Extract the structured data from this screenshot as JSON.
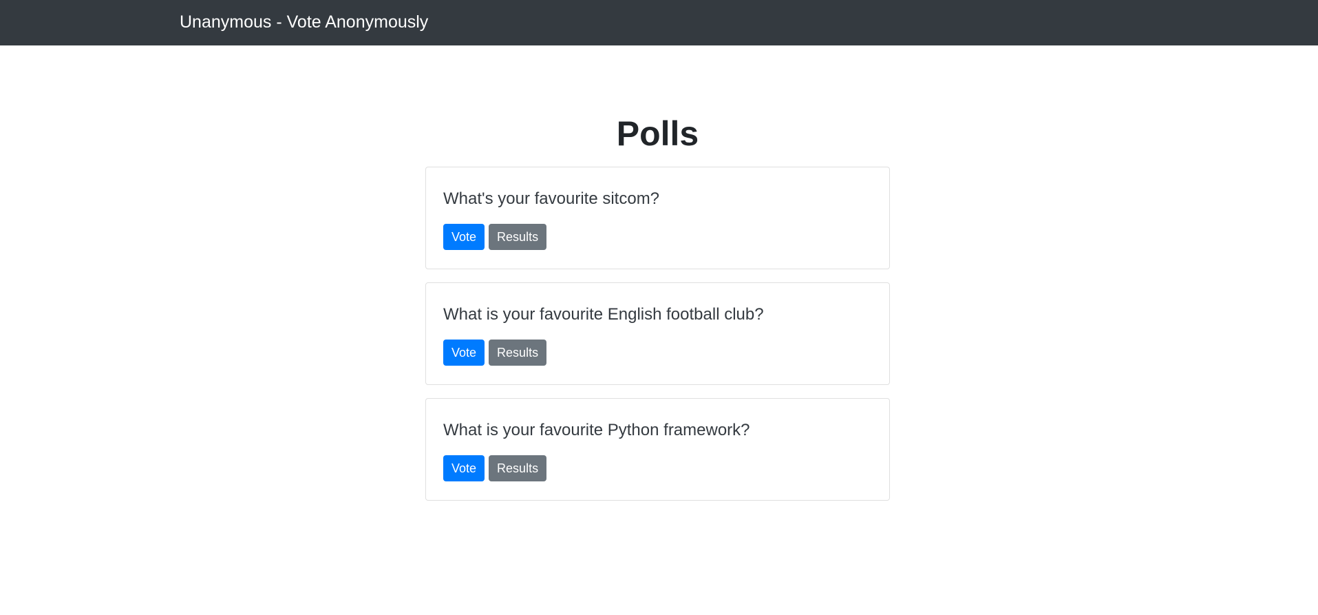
{
  "navbar": {
    "brand": "Unanymous - Vote Anonymously"
  },
  "page": {
    "title": "Polls"
  },
  "polls": [
    {
      "question": "What's your favourite sitcom?",
      "vote_label": "Vote",
      "results_label": "Results"
    },
    {
      "question": "What is your favourite English football club?",
      "vote_label": "Vote",
      "results_label": "Results"
    },
    {
      "question": "What is your favourite Python framework?",
      "vote_label": "Vote",
      "results_label": "Results"
    }
  ],
  "colors": {
    "navbar_bg": "#343a40",
    "primary": "#007bff",
    "secondary": "#6c757d"
  }
}
